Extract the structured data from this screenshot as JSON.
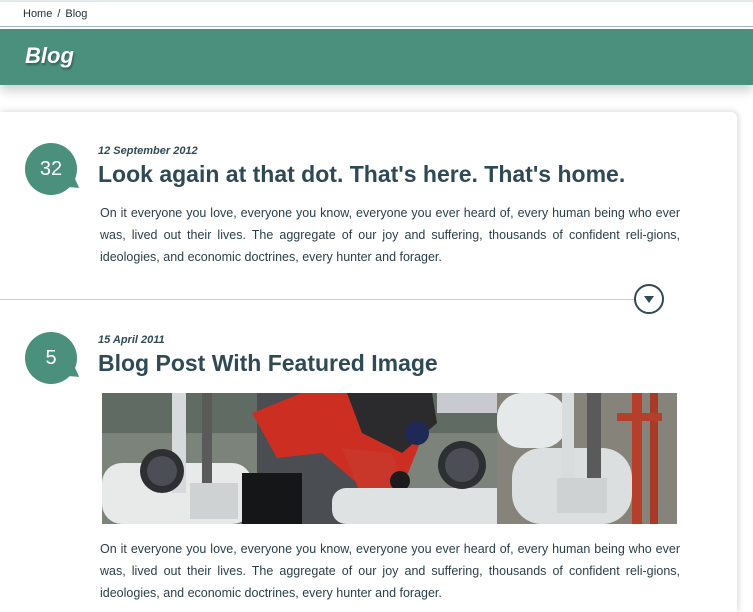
{
  "breadcrumb": {
    "home": "Home",
    "separator": "/",
    "current": "Blog"
  },
  "header": {
    "title": "Blog"
  },
  "posts": [
    {
      "comments": "32",
      "date": "12 September 2012",
      "title": "Look again at that dot. That's here. That's home.",
      "excerpt": "On it everyone you love, everyone you know, everyone you ever heard of, every human being who ever was, lived out their lives. The aggregate of our joy and suffering, thousands of confident reli-gions, ideologies, and economic doctrines, every hunter and forager."
    },
    {
      "comments": "5",
      "date": "15 April 2011",
      "title": "Blog Post With Featured Image",
      "image": "featured-image-worker-at-pipes",
      "excerpt": "On it everyone you love, everyone you know, everyone you ever heard of, every human being who ever was, lived out their lives. The aggregate of our joy and suffering, thousands of confident reli-gions, ideologies, and economic doctrines, every hunter and forager."
    }
  ],
  "colors": {
    "accent": "#4a907c",
    "text": "#2f4a55"
  }
}
